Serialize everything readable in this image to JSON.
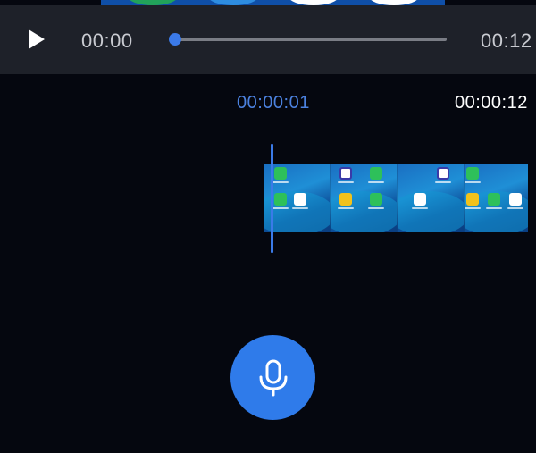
{
  "player": {
    "current_time": "00:00",
    "total_time": "00:12",
    "progress_fraction": 0.0,
    "play_icon": "play-icon",
    "accent_color": "#3b7ae8"
  },
  "timeline": {
    "current_position": "00:00:01",
    "end_time": "00:00:12",
    "playhead_color": "#3b7ae8"
  },
  "record": {
    "icon": "microphone-icon",
    "color": "#2f7bea"
  }
}
